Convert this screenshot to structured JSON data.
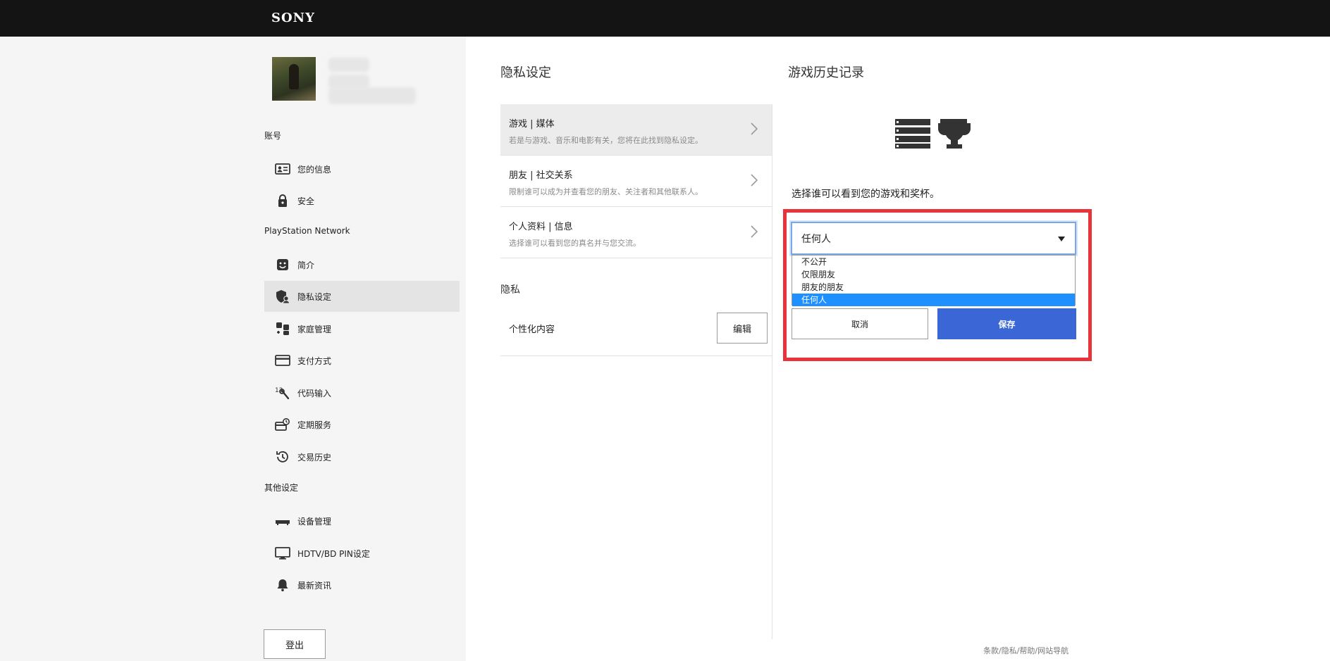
{
  "header": {
    "logo": "SONY"
  },
  "sidebar": {
    "sections": {
      "account": "账号",
      "psn": "PlayStation Network",
      "other": "其他设定"
    },
    "account_items": [
      {
        "label": "您的信息",
        "icon": "id-card-icon"
      },
      {
        "label": "安全",
        "icon": "lock-icon"
      }
    ],
    "psn_items": [
      {
        "label": "简介",
        "icon": "smiley-icon"
      },
      {
        "label": "隐私设定",
        "icon": "shield-user-icon"
      },
      {
        "label": "家庭管理",
        "icon": "family-icon"
      },
      {
        "label": "支付方式",
        "icon": "credit-card-icon"
      },
      {
        "label": "代码输入",
        "icon": "code-entry-icon"
      },
      {
        "label": "定期服务",
        "icon": "subscription-icon"
      },
      {
        "label": "交易历史",
        "icon": "history-icon"
      }
    ],
    "other_items": [
      {
        "label": "设备管理",
        "icon": "console-icon"
      },
      {
        "label": "HDTV/BD PIN设定",
        "icon": "monitor-icon"
      },
      {
        "label": "最新资讯",
        "icon": "bell-icon"
      }
    ],
    "logout_label": "登出"
  },
  "privacy": {
    "title": "隐私设定",
    "rows": [
      {
        "title": "游戏 | 媒体",
        "desc": "若是与游戏、音乐和电影有关，您将在此找到隐私设定。"
      },
      {
        "title": "朋友 | 社交关系",
        "desc": "限制谁可以成为并查看您的朋友、关注者和其他联系人。"
      },
      {
        "title": "个人资料 | 信息",
        "desc": "选择谁可以看到您的真名并与您交流。"
      }
    ],
    "sub_title": "隐私",
    "personalization_label": "个性化内容",
    "edit_label": "编辑"
  },
  "history": {
    "title": "游戏历史记录",
    "prompt": "选择谁可以看到您的游戏和奖杯。",
    "selected": "任何人",
    "options": [
      "不公开",
      "仅限朋友",
      "朋友的朋友",
      "任何人"
    ],
    "cancel_label": "取消",
    "save_label": "保存"
  },
  "footer": {
    "links": "条款/隐私/帮助/网站导航"
  },
  "colors": {
    "accent": "#3b67d6",
    "highlight": "#e8333a",
    "selected_option": "#1e90ff"
  }
}
